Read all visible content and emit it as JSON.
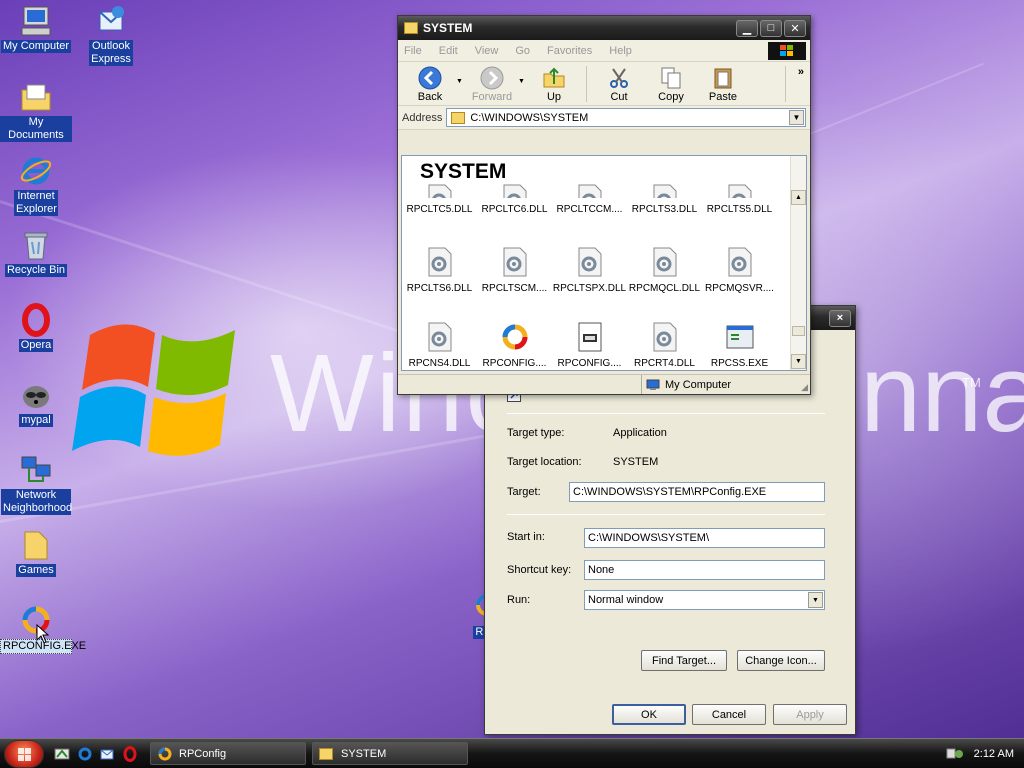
{
  "desktop": {
    "icons": [
      {
        "label": "My Computer",
        "icon": "my-computer-icon"
      },
      {
        "label": "Outlook Express",
        "icon": "outlook-express-icon"
      },
      {
        "label": "My Documents",
        "icon": "my-documents-icon"
      },
      {
        "label": "Internet Explorer",
        "icon": "internet-explorer-icon"
      },
      {
        "label": "Recycle Bin",
        "icon": "recycle-bin-icon"
      },
      {
        "label": "Opera",
        "icon": "opera-icon"
      },
      {
        "label": "mypal",
        "icon": "mypal-icon"
      },
      {
        "label": "Network Neighborhood",
        "icon": "network-neighborhood-icon"
      },
      {
        "label": "Games",
        "icon": "games-folder-icon"
      },
      {
        "label": "RPCONFIG.EXE",
        "icon": "rpconfig-icon"
      },
      {
        "label": "RPC",
        "icon": "rpconfig-icon"
      }
    ],
    "wallpaper_text_left": "Winc",
    "wallpaper_text_right": "nna",
    "wallpaper_tm": "TM"
  },
  "explorer": {
    "title": "SYSTEM",
    "menu": [
      "File",
      "Edit",
      "View",
      "Go",
      "Favorites",
      "Help"
    ],
    "toolbar": {
      "back": "Back",
      "forward": "Forward",
      "up": "Up",
      "cut": "Cut",
      "copy": "Copy",
      "paste": "Paste",
      "more": "»"
    },
    "address_label": "Address",
    "address_value": "C:\\WINDOWS\\SYSTEM",
    "folder_heading": "SYSTEM",
    "files_row1": [
      "RPCLTC5.DLL",
      "RPCLTC6.DLL",
      "RPCLTCCM....",
      "RPCLTS3.DLL",
      "RPCLTS5.DLL"
    ],
    "files_row2": [
      "RPCLTS6.DLL",
      "RPCLTSCM....",
      "RPCLTSPX.DLL",
      "RPCMQCL.DLL",
      "RPCMQSVR...."
    ],
    "files_row3": [
      "RPCNS4.DLL",
      "RPCONFIG....",
      "RPCONFIG....",
      "RPCRT4.DLL",
      "RPCSS.EXE"
    ],
    "status": "My Computer"
  },
  "properties": {
    "close": "×",
    "target_type_label": "Target type:",
    "target_type_value": "Application",
    "target_location_label": "Target location:",
    "target_location_value": "SYSTEM",
    "target_label": "Target:",
    "target_value": "C:\\WINDOWS\\SYSTEM\\RPConfig.EXE",
    "start_in_label": "Start in:",
    "start_in_value": "C:\\WINDOWS\\SYSTEM\\",
    "shortcut_key_label": "Shortcut key:",
    "shortcut_key_value": "None",
    "run_label": "Run:",
    "run_value": "Normal window",
    "find_target": "Find Target...",
    "change_icon": "Change Icon...",
    "ok": "OK",
    "cancel": "Cancel",
    "apply": "Apply"
  },
  "taskbar": {
    "tasks": [
      "RPConfig",
      "SYSTEM"
    ],
    "clock": "2:12 AM"
  },
  "colors": {
    "titlebar": "#2b2b2b",
    "desktop_label_bg": "#1a3f9e",
    "dialog_bg": "#ece9d8"
  }
}
